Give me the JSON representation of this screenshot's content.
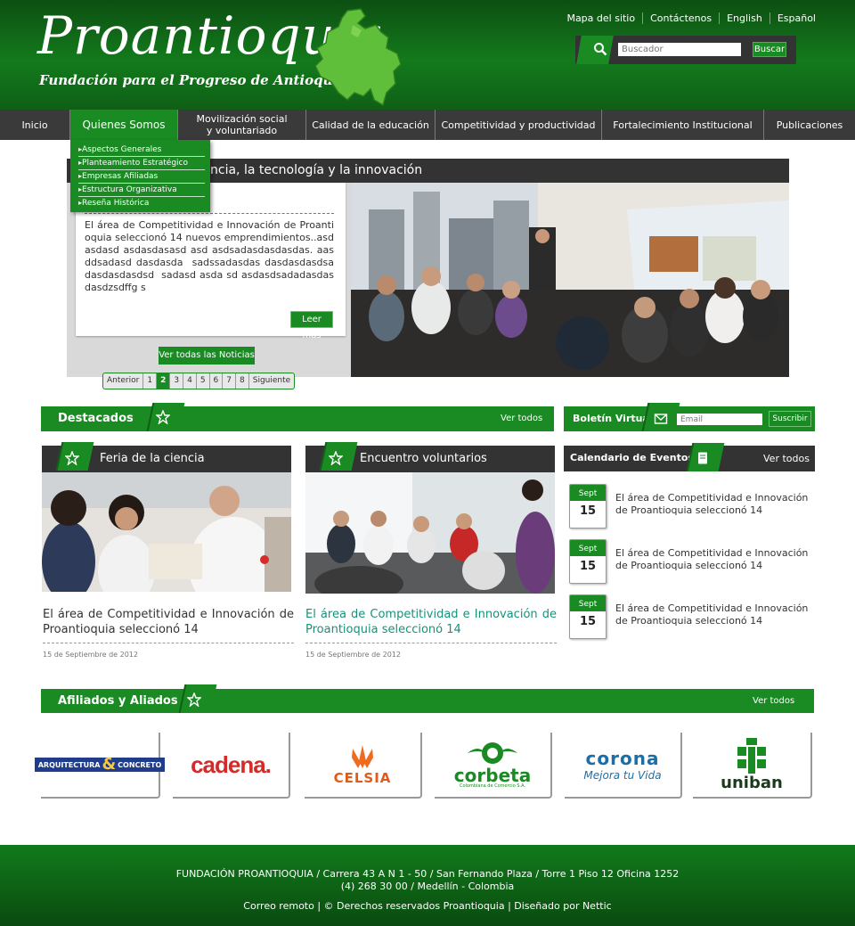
{
  "header": {
    "logo_title": "Proantioquia",
    "logo_subtitle": "Fundación para el Progreso de Antioquia",
    "top_links": [
      "Mapa del sitio",
      "Contáctenos",
      "English",
      "Español"
    ],
    "search": {
      "placeholder": "Buscador",
      "button": "Buscar"
    }
  },
  "nav": {
    "items": [
      "Inicio",
      "Quienes Somos",
      "Movilización social\ny voluntariado",
      "Calidad de la educación",
      "Competitividad y productividad",
      "Fortalecimiento Institucional",
      "Publicaciones"
    ],
    "active_index": 1,
    "submenu": [
      "Aspectos Generales",
      "Planteamiento Estratégico",
      "Empresas Afiliadas",
      "Estructura Organizativa",
      "Reseña Histórica"
    ]
  },
  "featured": {
    "title": "ncia, la tecnología y la innovación",
    "text": "El área de Competitividad e Innovación de Proantioquia seleccionó 14 nuevos emprendimientos..asdasdasd asdasdasasd asd asdsadasdasdasdas. aasddsadasd dasdasda  sadssadasdas dasdasdasdsadasdasdasdsd  sadasd asda sd asdasdsadadasdasdasdzsdffg s",
    "read_more": "Leer más",
    "all_news": "Ver todas las Noticias",
    "pager": [
      "Anterior",
      "1",
      "2",
      "3",
      "4",
      "5",
      "6",
      "7",
      "8",
      "Siguiente"
    ],
    "current_page": "2"
  },
  "destacados": {
    "title": "Destacados",
    "see_all": "Ver todos",
    "cards": [
      {
        "title": "Feria de la ciencia",
        "text": "El área de Competitividad e Innovación de Proantioquia seleccionó 14",
        "date": "15 de Septiembre de 2012"
      },
      {
        "title": "Encuentro voluntarios",
        "text": "El área de Competitividad e Innovación de Proantioquia seleccionó 14",
        "date": "15 de Septiembre de 2012"
      }
    ]
  },
  "boletin": {
    "title": "Boletín Virtual",
    "placeholder": "Email",
    "button": "Suscribir"
  },
  "calendario": {
    "title": "Calendario de Eventos",
    "see_all": "Ver todos",
    "events": [
      {
        "month": "Sept",
        "day": "15",
        "text": "El área de Competitividad e Innovación de Proantioquia seleccionó 14"
      },
      {
        "month": "Sept",
        "day": "15",
        "text": "El área de Competitividad e Innovación de Proantioquia seleccionó 14"
      },
      {
        "month": "Sept",
        "day": "15",
        "text": "El área de Competitividad e Innovación de Proantioquia seleccionó 14"
      }
    ]
  },
  "afiliados": {
    "title": "Afiliados y Aliados",
    "see_all": "Ver todos",
    "logos": [
      {
        "name": "ARQUITECTURA & CONCRETO",
        "main": "ARQUITECTURA",
        "amp": "&",
        "second": "CONCRETO"
      },
      {
        "name": "cadena",
        "main": "cadena."
      },
      {
        "name": "CELSIA",
        "main": "CELSIA"
      },
      {
        "name": "corbeta",
        "main": "corbeta",
        "tagline": "Colombiana de Comercio S.A."
      },
      {
        "name": "corona",
        "main": "corona",
        "tagline": "Mejora tu Vida"
      },
      {
        "name": "uniban",
        "main": "uniban"
      }
    ]
  },
  "footer": {
    "line1": "FUNDACIÓN PROANTIOQUIA / Carrera 43 A N 1 - 50 / San Fernando Plaza / Torre 1 Piso 12 Oficina 1252",
    "line2": "(4) 268 30 00 / Medellín -  Colombia",
    "line3": "Correo remoto | © Derechos reservados Proantioquia |  Diseñado por Nettic"
  },
  "colors": {
    "brand_green": "#1a8a23",
    "dark_green": "#0d4f12",
    "bar_dark": "#333333",
    "link_green": "#16927a"
  }
}
